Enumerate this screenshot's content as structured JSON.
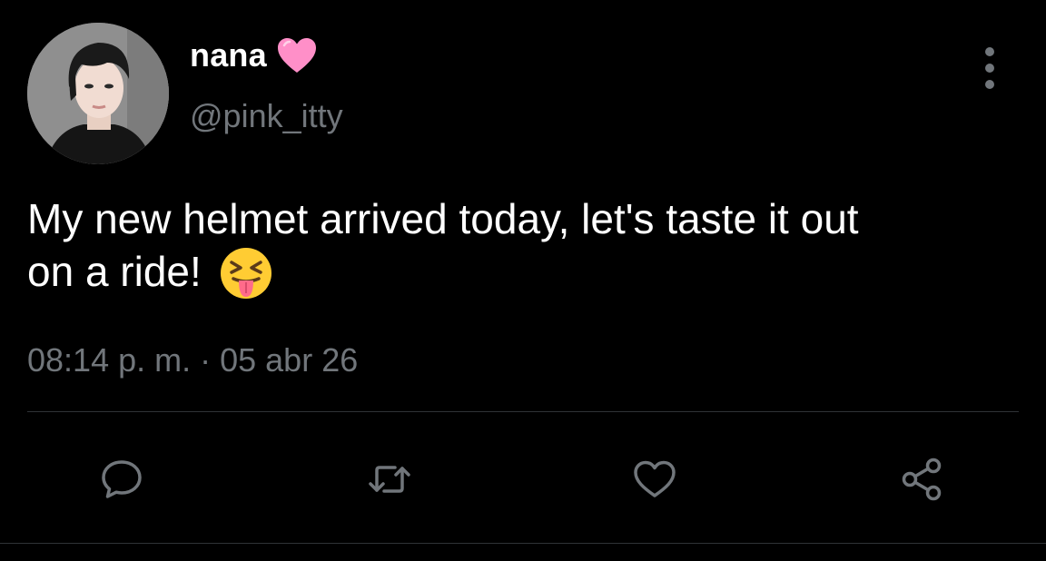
{
  "tweet": {
    "author": {
      "display_name": "nana",
      "name_emoji": "pink-heart",
      "handle": "@pink_itty"
    },
    "text_line1": "My new helmet arrived today, let's taste it out",
    "text_line2": "on a ride!",
    "text_emoji": "squinting-face-with-tongue",
    "timestamp": {
      "time": "08:14 p. m.",
      "separator": "·",
      "date": "05 abr 26"
    }
  },
  "actions": [
    {
      "name": "reply",
      "icon": "speech-bubble-icon"
    },
    {
      "name": "retweet",
      "icon": "retweet-arrows-icon"
    },
    {
      "name": "like",
      "icon": "heart-outline-icon"
    },
    {
      "name": "share",
      "icon": "share-nodes-icon"
    }
  ],
  "colors": {
    "background": "#000000",
    "primary_text": "#ffffff",
    "secondary_text": "#71767b",
    "divider": "#2f3336",
    "heart_emoji": "#ff8fc8"
  }
}
